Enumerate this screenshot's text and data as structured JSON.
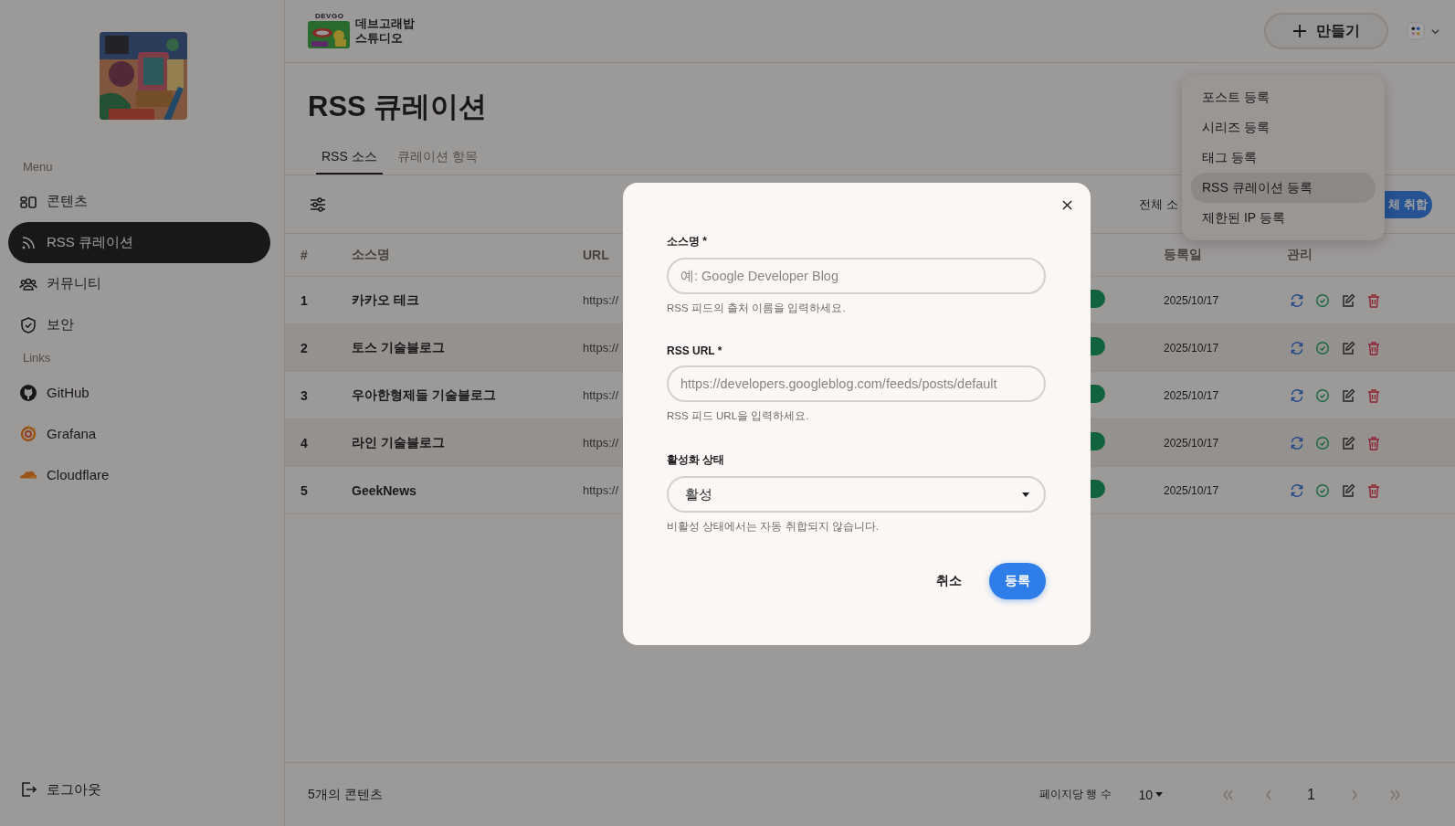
{
  "sidebar": {
    "sections": [
      {
        "label": "Menu",
        "items": [
          {
            "kind": "content",
            "label": "콘텐츠",
            "selected": false
          },
          {
            "kind": "rss",
            "label": "RSS 큐레이션",
            "selected": true
          },
          {
            "kind": "community",
            "label": "커뮤니티",
            "selected": false
          },
          {
            "kind": "security",
            "label": "보안",
            "selected": false
          }
        ]
      },
      {
        "label": "Links",
        "items": [
          {
            "kind": "github",
            "label": "GitHub",
            "selected": false
          },
          {
            "kind": "grafana",
            "label": "Grafana",
            "selected": false
          },
          {
            "kind": "cloudflare",
            "label": "Cloudflare",
            "selected": false
          }
        ]
      }
    ],
    "logout": "로그아웃"
  },
  "header": {
    "brand_mark": "DEVGO",
    "brand_lines": [
      "데브고래밥",
      "스튜디오"
    ],
    "create_button": "만들기"
  },
  "page": {
    "title": "RSS 큐레이션",
    "tabs": [
      {
        "label": "RSS 소스",
        "selected": true
      },
      {
        "label": "큐레이션 항목",
        "selected": false
      }
    ]
  },
  "toolbar": {
    "total_label": "전체 소",
    "collect_button": "체 취합"
  },
  "table": {
    "columns": [
      "#",
      "소스명",
      "URL",
      "등록일",
      "관리"
    ],
    "rows": [
      {
        "index": "1",
        "name": "카카오 테크",
        "url": "https://",
        "date": "2025/10/17"
      },
      {
        "index": "2",
        "name": "토스 기술블로그",
        "url": "https://",
        "date": "2025/10/17"
      },
      {
        "index": "3",
        "name": "우아한형제들 기술블로그",
        "url": "https://",
        "date": "2025/10/17"
      },
      {
        "index": "4",
        "name": "라인 기술블로그",
        "url": "https://",
        "date": "2025/10/17"
      },
      {
        "index": "5",
        "name": "GeekNews",
        "url": "https://",
        "date": "2025/10/17"
      }
    ]
  },
  "footer": {
    "count": "5개의 콘텐츠",
    "rows_per_page_label": "페이지당 행 수",
    "rows_per_page": "10",
    "page": "1",
    "nav": [
      {
        "kind": "first",
        "disabled": true
      },
      {
        "kind": "prev",
        "disabled": true
      },
      {
        "kind": "next",
        "disabled": true
      },
      {
        "kind": "last",
        "disabled": true
      }
    ]
  },
  "create_menu": {
    "items": [
      {
        "label": "포스트 등록",
        "selected": false
      },
      {
        "label": "시리즈 등록",
        "selected": false
      },
      {
        "label": "태그 등록",
        "selected": false
      },
      {
        "label": "RSS 큐레이션 등록",
        "selected": true
      },
      {
        "label": "제한된 IP 등록",
        "selected": false
      }
    ]
  },
  "dialog": {
    "fields": [
      {
        "kind": "text",
        "label": "소스명 *",
        "placeholder": "예: Google Developer Blog",
        "help": "RSS 피드의 출처 이름을 입력하세요."
      },
      {
        "kind": "text",
        "label": "RSS URL *",
        "placeholder": "https://developers.googleblog.com/feeds/posts/default",
        "help": "RSS 피드 URL을 입력하세요."
      },
      {
        "kind": "select",
        "label": "활성화 상태",
        "value": "활성",
        "help": "비활성 상태에서는 자동 취합되지 않습니다."
      }
    ],
    "cancel": "취소",
    "submit": "등록"
  }
}
